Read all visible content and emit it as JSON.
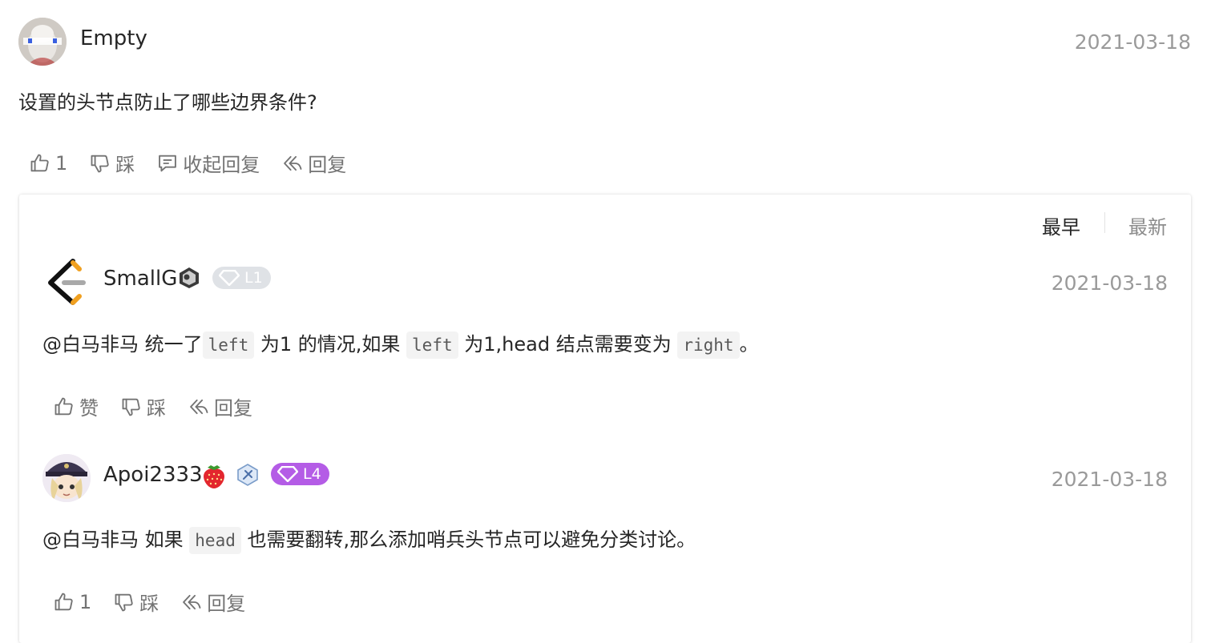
{
  "comment": {
    "username": "Empty",
    "date": "2021-03-18",
    "text": "设置的头节点防止了哪些边界条件?",
    "likes": "1",
    "dislike_label": "踩",
    "collapse_label": "收起回复",
    "reply_label": "回复"
  },
  "sort": {
    "earliest": "最早",
    "latest": "最新"
  },
  "replies": [
    {
      "username": "SmallG",
      "level": "L1",
      "date": "2021-03-18",
      "parts": [
        "@白马非马 统一了",
        "left",
        "为1 的情况,如果",
        "left",
        "为1,head 结点需要变为",
        "right",
        "。"
      ],
      "like_label": "赞",
      "dislike_label": "踩",
      "reply_label": "回复"
    },
    {
      "username": "Apoi2333",
      "level": "L4",
      "date": "2021-03-18",
      "parts": [
        "@白马非马 如果",
        "head",
        "也需要翻转,那么添加哨兵头节点可以避免分类讨论。"
      ],
      "like_label": "1",
      "dislike_label": "踩",
      "reply_label": "回复"
    }
  ],
  "colors": {
    "level1_badge": "#d4d8de",
    "level4_badge": "#b45ce6",
    "logo_orange": "#f0a020",
    "muted": "#9a9a9a"
  },
  "icons": {
    "like": "thumbs-up-icon",
    "dislike": "thumbs-down-icon",
    "collapse": "comment-icon",
    "reply": "reply-arrow-icon",
    "diamond": "diamond-icon",
    "strawberry": "strawberry-icon"
  }
}
